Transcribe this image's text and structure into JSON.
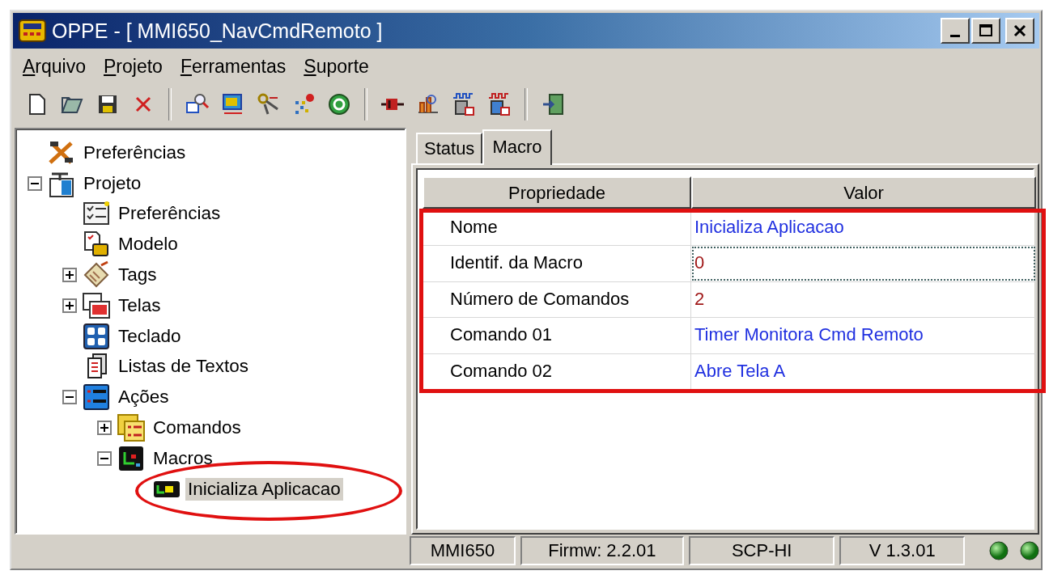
{
  "window": {
    "title": "OPPE - [ MMI650_NavCmdRemoto ]"
  },
  "menu": [
    "Arquivo",
    "Projeto",
    "Ferramentas",
    "Suporte"
  ],
  "tree": [
    {
      "label": "Preferências",
      "selected": false,
      "circled": false
    },
    {
      "label": "Projeto",
      "selected": false,
      "circled": false,
      "expanded": true,
      "children": [
        {
          "label": "Preferências",
          "selected": false,
          "circled": false
        },
        {
          "label": "Modelo",
          "selected": false,
          "circled": false
        },
        {
          "label": "Tags",
          "selected": false,
          "circled": false,
          "expanded": false
        },
        {
          "label": "Telas",
          "selected": false,
          "circled": false,
          "expanded": false
        },
        {
          "label": "Teclado",
          "selected": false,
          "circled": false
        },
        {
          "label": "Listas de Textos",
          "selected": false,
          "circled": false
        },
        {
          "label": "Ações",
          "selected": false,
          "circled": false,
          "expanded": true,
          "children": [
            {
              "label": "Comandos",
              "selected": false,
              "circled": false,
              "expanded": false
            },
            {
              "label": "Macros",
              "selected": false,
              "circled": false,
              "expanded": true,
              "children": [
                {
                  "label": "Inicializa Aplicacao",
                  "selected": true,
                  "circled": true
                }
              ]
            }
          ]
        }
      ]
    }
  ],
  "tabs": [
    {
      "label": "Status",
      "selected": false
    },
    {
      "label": "Macro",
      "selected": true
    }
  ],
  "table": {
    "columns": [
      "Propriedade",
      "Valor"
    ],
    "framed": true,
    "rows": [
      {
        "property": "Nome",
        "value": "Inicializa Aplicacao",
        "kind": "text",
        "focused": false
      },
      {
        "property": "Identif. da Macro",
        "value": "0",
        "kind": "number",
        "focused": true
      },
      {
        "property": "Número de Comandos",
        "value": "2",
        "kind": "number",
        "focused": false
      },
      {
        "property": "Comando 01",
        "value": "Timer Monitora Cmd Remoto",
        "kind": "text",
        "focused": false
      },
      {
        "property": "Comando 02",
        "value": "Abre Tela A",
        "kind": "text",
        "focused": false
      }
    ]
  },
  "status_bar": {
    "panels": [
      "MMI650",
      "Firmw: 2.2.01",
      "SCP-HI",
      "V 1.3.01"
    ],
    "leds": [
      {
        "on": true
      },
      {
        "on": true
      }
    ]
  }
}
